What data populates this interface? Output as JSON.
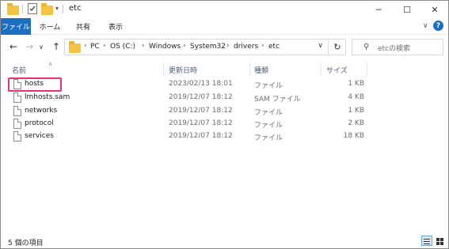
{
  "window": {
    "title": "etc",
    "minimize": "─",
    "maximize": "☐",
    "close": "✕"
  },
  "ribbon": {
    "tabs": [
      "ファイル",
      "ホーム",
      "共有",
      "表示"
    ],
    "expand_icon": "chevron-down-icon",
    "help_glyph": "?"
  },
  "nav": {
    "back": "←",
    "forward": "→",
    "recent": "∨",
    "up": "↑",
    "breadcrumb": [
      "PC",
      "OS (C:)",
      "Windows",
      "System32",
      "drivers",
      "etc"
    ],
    "refresh": "↻"
  },
  "search": {
    "placeholder": "etcの検索"
  },
  "columns": {
    "name": "名前",
    "date": "更新日時",
    "type": "種類",
    "size": "サイズ"
  },
  "files": [
    {
      "name": "hosts",
      "date": "2023/02/13 18:01",
      "type": "ファイル",
      "size": "1 KB"
    },
    {
      "name": "lmhosts.sam",
      "date": "2019/12/07 18:12",
      "type": "SAM ファイル",
      "size": "4 KB"
    },
    {
      "name": "networks",
      "date": "2019/12/07 18:12",
      "type": "ファイル",
      "size": "1 KB"
    },
    {
      "name": "protocol",
      "date": "2019/12/07 18:12",
      "type": "ファイル",
      "size": "2 KB"
    },
    {
      "name": "services",
      "date": "2019/12/07 18:12",
      "type": "ファイル",
      "size": "18 KB"
    }
  ],
  "status": {
    "item_count": "5 個の項目"
  },
  "colors": {
    "accent": "#1a6fc2",
    "highlight": "#e8356d",
    "folder": "#f5c342"
  }
}
